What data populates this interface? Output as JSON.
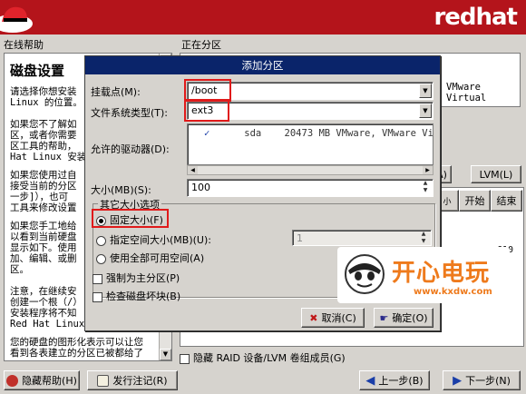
{
  "banner": {
    "brand": "redhat"
  },
  "help": {
    "pane_title": "在线帮助",
    "heading": "磁盘设置",
    "paragraphs": [
      "请选择你想安装\nLinux 的位置。",
      "如果您不了解如\n区，或者你需要\n区工具的帮助，\nHat Linux 安装",
      "如果您使用过自\n接受当前的分区\n一步]），也可\n工具来修改设置",
      "如果您手工地给\n以看到当前硬盘\n显示如下。使用\n加、编辑、或删\n区。",
      "注意，在继续安\n创建一个根（/）\n安装程序将不知\nRed Hat Linux。",
      "您的硬盘的图形化表示可以让您\n看到各表建立的分区已被都给了"
    ]
  },
  "partitions": {
    "title": "正在分区",
    "disk_label": "VMware Virtual",
    "button_partial": "A)",
    "lvm_button": "LVM(L)",
    "col_small": "小",
    "col_start": "开始",
    "col_end": "结束",
    "cyl_value": "610",
    "hide_raid_label": "隐藏 RAID 设备/LVM 卷组成员(G)"
  },
  "dialog": {
    "title": "添加分区",
    "mount_point_label": "挂载点(M):",
    "mount_point_value": "/boot",
    "fs_type_label": "文件系统类型(T):",
    "fs_type_value": "ext3",
    "allowed_drives_label": "允许的驱动器(D):",
    "drive": {
      "checked": true,
      "name": "sda",
      "description": "20473 MB VMware, VMware Virtual"
    },
    "size_label": "大小(MB)(S):",
    "size_value": "100",
    "other_size_legend": "其它大小选项",
    "size_options": [
      {
        "label": "固定大小(F)",
        "selected": true
      },
      {
        "label": "指定空间大小(MB)(U):",
        "selected": false
      },
      {
        "label": "使用全部可用空间(A)",
        "selected": false
      }
    ],
    "fill_to_value": "1",
    "force_primary_label": "强制为主分区(P)",
    "check_bad_blocks_label": "检查磁盘坏块(B)",
    "cancel_label": "取消(C)",
    "ok_label": "确定(O)"
  },
  "bottom": {
    "hide_help_label": "隐藏帮助(H)",
    "release_notes_label": "发行注记(R)",
    "back_label": "上一步(B)",
    "next_label": "下一步(N)"
  },
  "watermark": {
    "text": "开心电玩",
    "url": "www.kxdw.com"
  },
  "colors": {
    "banner": "#b4141b",
    "dialog_title": "#0a246a",
    "highlight_box": "#e01a1a",
    "watermark": "#ee7a1c"
  }
}
